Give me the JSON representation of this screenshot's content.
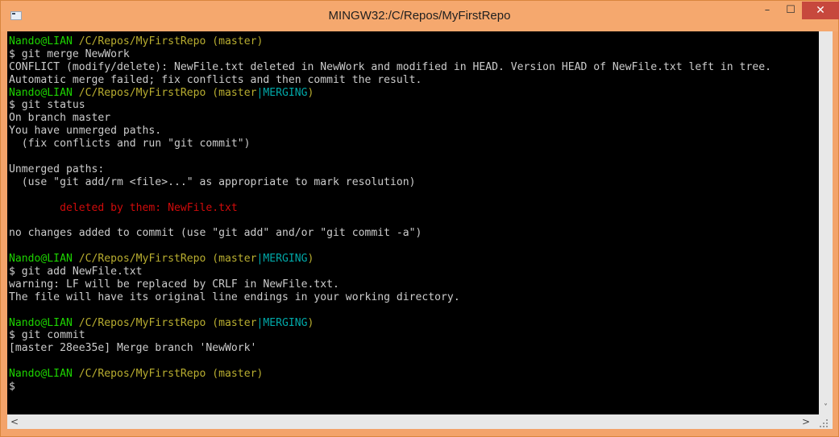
{
  "window": {
    "title": "MINGW32:/C/Repos/MyFirstRepo",
    "controls": {
      "minimize": "–",
      "maximize": "☐",
      "close": "✕"
    },
    "icon": "terminal-app-icon"
  },
  "terminal": {
    "lines": [
      [
        {
          "t": "Nando@LIAN",
          "c": "u"
        },
        {
          "t": " /C/Repos/MyFirstRepo (master)",
          "c": "p"
        }
      ],
      [
        {
          "t": "$ git merge NewWork",
          "c": ""
        }
      ],
      [
        {
          "t": "CONFLICT (modify/delete): NewFile.txt deleted in NewWork and modified in HEAD. Version HEAD of NewFile.txt left in tree.",
          "c": ""
        }
      ],
      [
        {
          "t": "Automatic merge failed; fix conflicts and then commit the result.",
          "c": ""
        }
      ],
      [
        {
          "t": "Nando@LIAN",
          "c": "u"
        },
        {
          "t": " /C/Repos/MyFirstRepo (master",
          "c": "p"
        },
        {
          "t": "|MERGING",
          "c": "br"
        },
        {
          "t": ")",
          "c": "p"
        }
      ],
      [
        {
          "t": "$ git status",
          "c": ""
        }
      ],
      [
        {
          "t": "On branch master",
          "c": ""
        }
      ],
      [
        {
          "t": "You have unmerged paths.",
          "c": ""
        }
      ],
      [
        {
          "t": "  (fix conflicts and run \"git commit\")",
          "c": ""
        }
      ],
      [
        {
          "t": "",
          "c": ""
        }
      ],
      [
        {
          "t": "Unmerged paths:",
          "c": ""
        }
      ],
      [
        {
          "t": "  (use \"git add/rm <file>...\" as appropriate to mark resolution)",
          "c": ""
        }
      ],
      [
        {
          "t": "",
          "c": ""
        }
      ],
      [
        {
          "t": "        deleted by them: NewFile.txt",
          "c": "red"
        }
      ],
      [
        {
          "t": "",
          "c": ""
        }
      ],
      [
        {
          "t": "no changes added to commit (use \"git add\" and/or \"git commit -a\")",
          "c": ""
        }
      ],
      [
        {
          "t": "",
          "c": ""
        }
      ],
      [
        {
          "t": "Nando@LIAN",
          "c": "u"
        },
        {
          "t": " /C/Repos/MyFirstRepo (master",
          "c": "p"
        },
        {
          "t": "|MERGING",
          "c": "br"
        },
        {
          "t": ")",
          "c": "p"
        }
      ],
      [
        {
          "t": "$ git add NewFile.txt",
          "c": ""
        }
      ],
      [
        {
          "t": "warning: LF will be replaced by CRLF in NewFile.txt.",
          "c": ""
        }
      ],
      [
        {
          "t": "The file will have its original line endings in your working directory.",
          "c": ""
        }
      ],
      [
        {
          "t": "",
          "c": ""
        }
      ],
      [
        {
          "t": "Nando@LIAN",
          "c": "u"
        },
        {
          "t": " /C/Repos/MyFirstRepo (master",
          "c": "p"
        },
        {
          "t": "|MERGING",
          "c": "br"
        },
        {
          "t": ")",
          "c": "p"
        }
      ],
      [
        {
          "t": "$ git commit",
          "c": ""
        }
      ],
      [
        {
          "t": "[master 28ee35e] Merge branch 'NewWork'",
          "c": ""
        }
      ],
      [
        {
          "t": "",
          "c": ""
        }
      ],
      [
        {
          "t": "Nando@LIAN",
          "c": "u"
        },
        {
          "t": " /C/Repos/MyFirstRepo (master)",
          "c": "p"
        }
      ],
      [
        {
          "t": "$",
          "c": ""
        }
      ]
    ]
  },
  "scrollbars": {
    "vertical_down": "˅",
    "horizontal_left": "<",
    "horizontal_right": ">"
  },
  "colors": {
    "titlebar": "#f5a86e",
    "terminal_bg": "#000000",
    "user_host": "#1dd400",
    "path": "#b9ae30",
    "merging": "#01a8a8",
    "conflict": "#d10b0b",
    "close_button": "#c7483d"
  }
}
